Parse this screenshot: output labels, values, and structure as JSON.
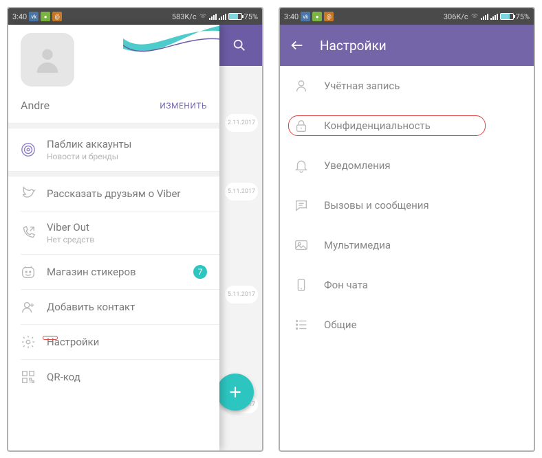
{
  "colors": {
    "accent_purple": "#7464a8",
    "accent_teal": "#2dc5c0",
    "highlight_red": "#d44"
  },
  "left": {
    "statusbar": {
      "time": "3:40",
      "speed": "583K/c",
      "battery_pct": "75%"
    },
    "profile": {
      "name": "Andre",
      "edit_label": "ИЗМЕНИТЬ"
    },
    "drawer": {
      "public_accounts": {
        "title": "Паблик аккаунты",
        "sub": "Новости и бренды"
      },
      "tell_friends": "Рассказать друзьям о Viber",
      "viber_out": {
        "title": "Viber Out",
        "sub": "Нет средств"
      },
      "stickers": {
        "title": "Магазин стикеров",
        "badge": "7"
      },
      "add_contact": "Добавить контакт",
      "settings": "Настройки",
      "qr": "QR-код"
    },
    "bg_dates": [
      "2.11.2017",
      "5.11.2017",
      "5.11.2017",
      "9.10.2017"
    ]
  },
  "right": {
    "statusbar": {
      "time": "3:40",
      "speed": "306K/c",
      "battery_pct": "75%"
    },
    "appbar_title": "Настройки",
    "items": {
      "account": "Учётная запись",
      "privacy": "Конфиденциальность",
      "notifications": "Уведомления",
      "calls_messages": "Вызовы и сообщения",
      "multimedia": "Мультимедиа",
      "chat_bg": "Фон чата",
      "general": "Общие"
    }
  }
}
